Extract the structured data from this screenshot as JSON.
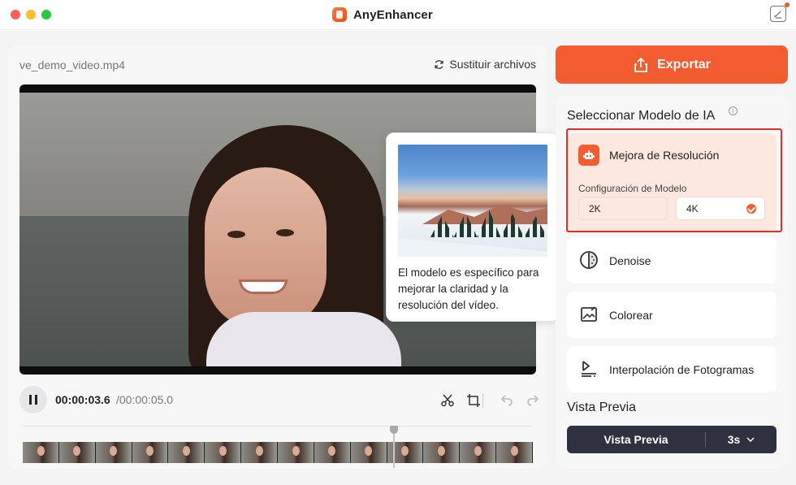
{
  "app": {
    "title": "AnyEnhancer"
  },
  "video_panel": {
    "file_name": "ve_demo_video.mp4",
    "replace_label": "Sustituir archivos",
    "time_current": "00:00:03.6",
    "time_total": "/00:00:05.0"
  },
  "tooltip": {
    "text": "El modelo es específico para mejorar la claridad y la resolución del vídeo."
  },
  "export": {
    "label": "Exportar"
  },
  "model_section": {
    "title": "Seleccionar Modelo de IA",
    "models": [
      {
        "label": "Mejora de Resolución",
        "icon": "robot-icon",
        "selected": true
      },
      {
        "label": "Denoise",
        "icon": "denoise-icon"
      },
      {
        "label": "Colorear",
        "icon": "colorize-icon"
      },
      {
        "label": "Interpolación de Fotogramas",
        "icon": "frame-interpolation-icon"
      }
    ],
    "config_label": "Configuración de Modelo",
    "resolution_options": [
      "2K",
      "4K"
    ],
    "selected_resolution": "4K"
  },
  "preview_section": {
    "title": "Vista Previa",
    "button_label": "Vista Previa",
    "duration": "3s"
  },
  "colors": {
    "accent": "#f35b31",
    "selection_outline": "#e02e24",
    "preview_bar": "#2d3140"
  }
}
